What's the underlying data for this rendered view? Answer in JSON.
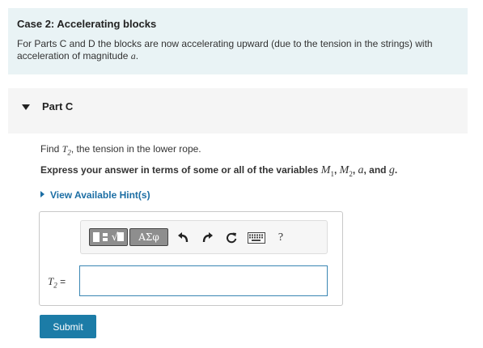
{
  "case": {
    "title": "Case 2: Accelerating blocks",
    "desc_before": "For Parts C and D the blocks are now accelerating upward (due to the tension in the strings) with acceleration of magnitude ",
    "desc_var": "a",
    "desc_after": "."
  },
  "part": {
    "label": "Part C"
  },
  "question": {
    "find": "Find ",
    "var_T": "T",
    "var_sub": "2",
    "rest": ", the tension in the lower rope."
  },
  "instruction": {
    "prefix": "Express your answer in terms of some or all of the variables ",
    "M1": "M",
    "M1_sub": "1",
    "sep1": ", ",
    "M2": "M",
    "M2_sub": "2",
    "sep2": ", ",
    "a": "a",
    "sep3": ", and ",
    "g": "g",
    "end": "."
  },
  "hint": {
    "label": "View Available Hint(s)"
  },
  "toolbar": {
    "templates_icon": "templates-icon",
    "greek_label": "ΑΣφ",
    "undo_icon": "undo-icon",
    "redo_icon": "redo-icon",
    "reset_icon": "reset-icon",
    "keyboard_icon": "keyboard-icon",
    "help_label": "?"
  },
  "answer": {
    "var": "T",
    "var_sub": "2",
    "equals": "=",
    "value": ""
  },
  "submit": {
    "label": "Submit"
  },
  "colors": {
    "accent": "#1c7ca7",
    "link": "#1c6ea4",
    "case_bg": "#e9f3f5",
    "input_border": "#3a86b3"
  }
}
